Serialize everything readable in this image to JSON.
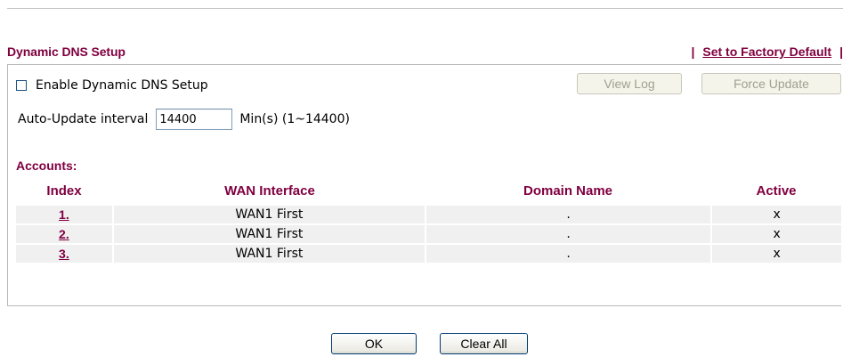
{
  "header": {
    "title": "Dynamic DNS Setup",
    "separator": "|",
    "factory_default_label": "Set to Factory Default"
  },
  "settings": {
    "enable_label": "Enable Dynamic DNS Setup",
    "enabled": false,
    "view_log_label": "View Log",
    "force_update_label": "Force Update",
    "interval_label": "Auto-Update interval",
    "interval_value": "14400",
    "interval_unit": "Min(s) (1~14400)"
  },
  "accounts": {
    "title": "Accounts:",
    "columns": {
      "index": "Index",
      "wan": "WAN Interface",
      "domain": "Domain Name",
      "active": "Active"
    },
    "rows": [
      {
        "index": "1.",
        "wan": "WAN1 First",
        "domain": ".",
        "active": "x"
      },
      {
        "index": "2.",
        "wan": "WAN1 First",
        "domain": ".",
        "active": "x"
      },
      {
        "index": "3.",
        "wan": "WAN1 First",
        "domain": ".",
        "active": "x"
      }
    ]
  },
  "footer": {
    "ok_label": "OK",
    "clear_all_label": "Clear All"
  },
  "colors": {
    "accent": "#800040",
    "row_background": "#f0f0f0"
  }
}
